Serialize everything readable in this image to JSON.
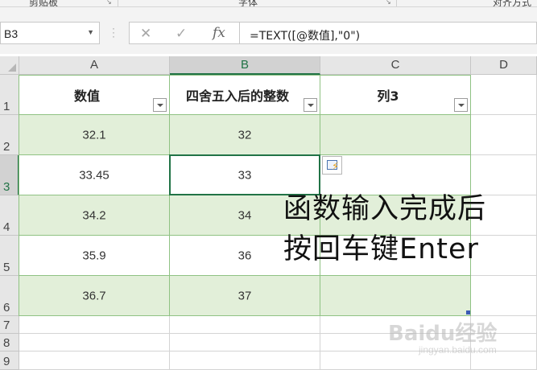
{
  "ribbon": {
    "groups": [
      "剪贴板",
      "字体",
      "对齐方式"
    ]
  },
  "formula_bar": {
    "name_box": "B3",
    "cancel_icon": "close-icon",
    "enter_icon": "checkmark-icon",
    "fx_label": "fx",
    "formula": "=TEXT([@数值],\"0\")"
  },
  "columns": [
    "A",
    "B",
    "C",
    "D"
  ],
  "rows": [
    "1",
    "2",
    "3",
    "4",
    "5",
    "6",
    "7",
    "8",
    "9"
  ],
  "selected_cell": {
    "column": "B",
    "row": "3"
  },
  "table": {
    "headers": [
      "数值",
      "四舍五入后的整数",
      "列3"
    ],
    "rows": [
      [
        "32.1",
        "32",
        ""
      ],
      [
        "33.45",
        "33",
        ""
      ],
      [
        "34.2",
        "34",
        ""
      ],
      [
        "35.9",
        "36",
        ""
      ],
      [
        "36.7",
        "37",
        ""
      ]
    ]
  },
  "annotation": {
    "line1": "函数输入完成后",
    "line2": "按回车键Enter"
  },
  "watermark": {
    "logo": "Baidu经验",
    "url": "jingyan.baidu.com"
  },
  "colors": {
    "accent": "#217346",
    "band": "#e2efd9",
    "table_border": "#8fc283"
  }
}
